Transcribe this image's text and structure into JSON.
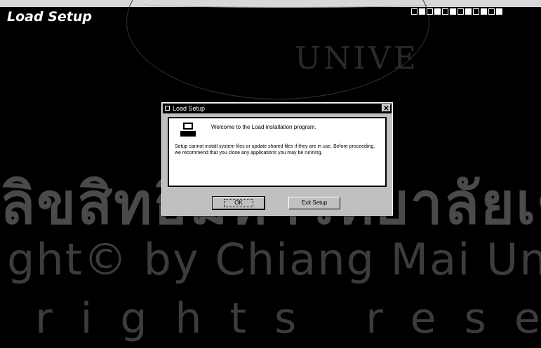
{
  "app": {
    "title": "Load Setup"
  },
  "tray": {
    "icons": [
      "tray-icon-1",
      "tray-icon-2",
      "tray-icon-3",
      "tray-icon-4",
      "tray-icon-5",
      "tray-icon-6",
      "tray-icon-7",
      "tray-icon-8",
      "tray-icon-9",
      "tray-icon-10",
      "tray-icon-11",
      "tray-icon-12"
    ]
  },
  "watermark": {
    "line1": "UNIVE",
    "line2": "ลิขสิทธิ์มหาวิทยาลัยเชียงใหม่",
    "line3": "ght© by Chiang Mai Un",
    "line4": "rights rese"
  },
  "dialog": {
    "title": "Load Setup",
    "welcome": "Welcome to the Load installation program.",
    "warning": "Setup cannot install system files or update shared files if they are in use. Before proceeding, we recommend that you close any applications you may be running.",
    "ok_label": "OK",
    "exit_label": "Exit Setup",
    "close_glyph": "✕"
  }
}
